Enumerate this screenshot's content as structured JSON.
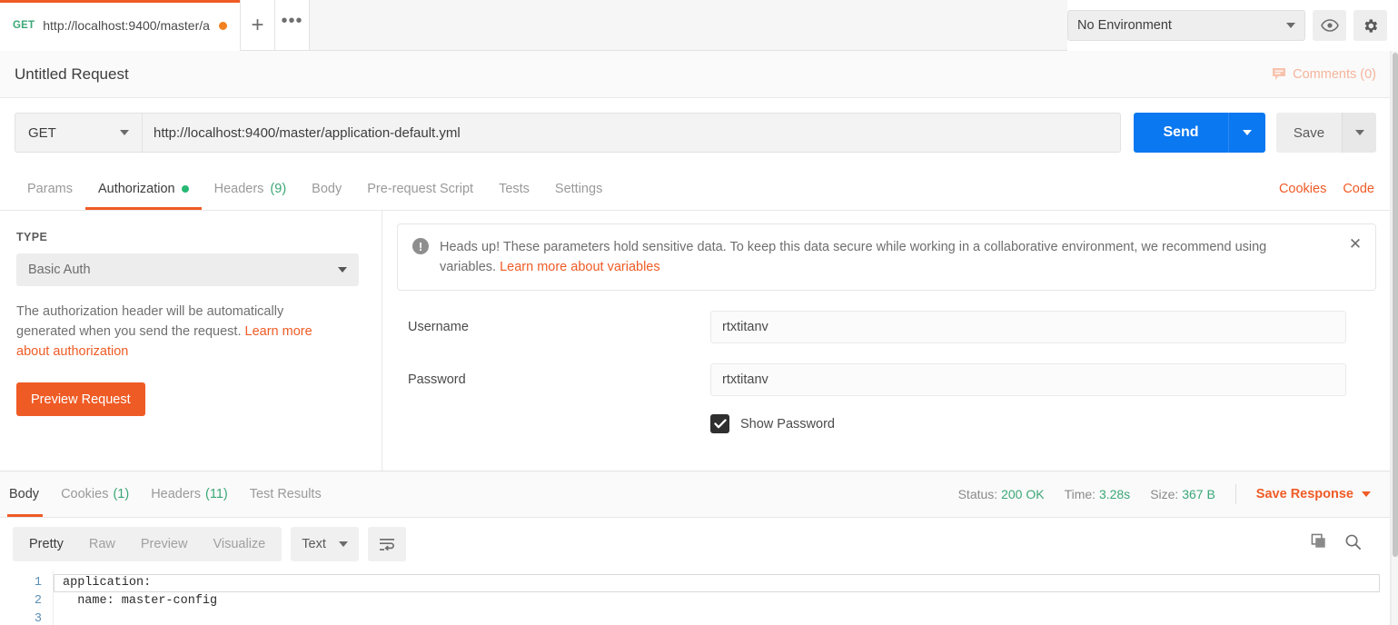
{
  "tabstrip": {
    "request_tab": {
      "method": "GET",
      "url": "http://localhost:9400/master/a...",
      "unsaved_dot": "unsaved-indicator"
    },
    "new_tab_label": "+",
    "more_label": "•••",
    "environment": {
      "selected": "No Environment"
    },
    "eye_icon": "eye-icon",
    "gear_icon": "gear-icon"
  },
  "title_row": {
    "title": "Untitled Request",
    "comments_label": "Comments (0)"
  },
  "urlbar": {
    "method": "GET",
    "url": "http://localhost:9400/master/application-default.yml",
    "send_label": "Send",
    "save_label": "Save"
  },
  "request_tabs": {
    "items": [
      {
        "label": "Params",
        "badge": "",
        "active": false
      },
      {
        "label": "Authorization",
        "badge": "",
        "active": true
      },
      {
        "label": "Headers",
        "badge": "(9)",
        "active": false
      },
      {
        "label": "Body",
        "badge": "",
        "active": false
      },
      {
        "label": "Pre-request Script",
        "badge": "",
        "active": false
      },
      {
        "label": "Tests",
        "badge": "",
        "active": false
      },
      {
        "label": "Settings",
        "badge": "",
        "active": false
      }
    ],
    "cookies_label": "Cookies",
    "code_label": "Code"
  },
  "auth": {
    "type_heading": "TYPE",
    "type_value": "Basic Auth",
    "description": "The authorization header will be automatically generated when you send the request. ",
    "description_link": "Learn more about authorization",
    "preview_button": "Preview Request",
    "banner": {
      "text": "Heads up! These parameters hold sensitive data. To keep this data secure while working in a collaborative environment, we recommend using variables. ",
      "link": "Learn more about variables",
      "close_label": "✕"
    },
    "username_label": "Username",
    "username_value": "rtxtitanv",
    "password_label": "Password",
    "password_value": "rtxtitanv",
    "show_password_label": "Show Password",
    "show_password_checked": true
  },
  "response": {
    "tabs": [
      {
        "label": "Body",
        "badge": "",
        "active": true
      },
      {
        "label": "Cookies",
        "badge": "(1)",
        "active": false
      },
      {
        "label": "Headers",
        "badge": "(11)",
        "active": false
      },
      {
        "label": "Test Results",
        "badge": "",
        "active": false
      }
    ],
    "status_label": "Status:",
    "status_value": "200 OK",
    "time_label": "Time:",
    "time_value": "3.28s",
    "size_label": "Size:",
    "size_value": "367 B",
    "save_response_label": "Save Response"
  },
  "body_toolbar": {
    "views": [
      {
        "label": "Pretty",
        "active": true
      },
      {
        "label": "Raw",
        "active": false
      },
      {
        "label": "Preview",
        "active": false
      },
      {
        "label": "Visualize",
        "active": false
      }
    ],
    "format": "Text",
    "wrap_icon": "word-wrap-icon",
    "copy_icon": "copy-icon",
    "search_icon": "search-icon"
  },
  "code": {
    "lines": [
      {
        "num": "1",
        "text": "application:"
      },
      {
        "num": "2",
        "text": "  name: master-config"
      },
      {
        "num": "3",
        "text": ""
      }
    ]
  },
  "colors": {
    "accent_orange": "#ef5b25",
    "send_blue": "#0a78f0",
    "success_green": "#3ba776",
    "method_green": "#3ba776",
    "muted_text": "#9a9a9a"
  }
}
